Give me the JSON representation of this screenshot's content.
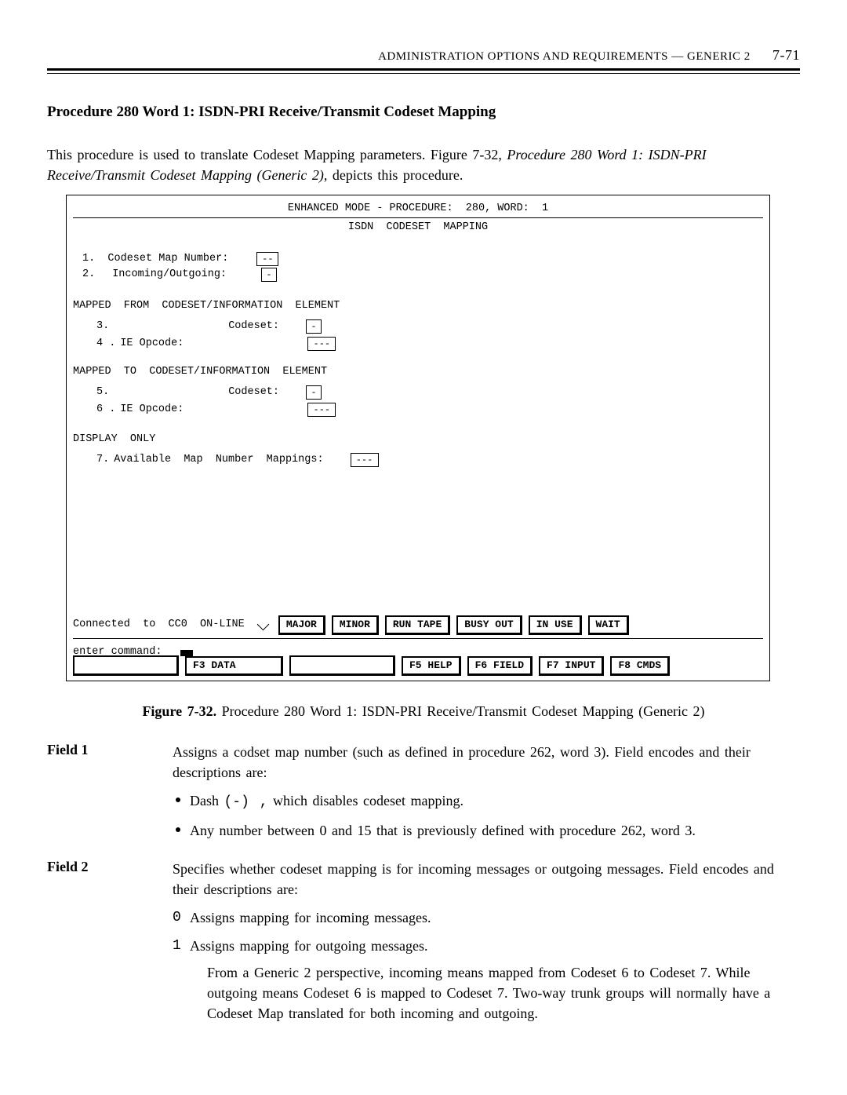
{
  "header": {
    "running": "ADMINISTRATION  OPTIONS  AND  REQUIREMENTS   —   GENERIC  2",
    "page_number": "7-71"
  },
  "section_title": "Procedure 280 Word 1: ISDN-PRI Receive/Transmit Codeset Mapping",
  "intro_prefix": "This  procedure  is  used  to  translate  Codeset  Mapping  parameters.  Figure  7-32, ",
  "intro_em": "Procedure  280 Word 1: ISDN-PRI Receive/Transmit Codeset Mapping (Generic 2),",
  "intro_suffix": " depicts this procedure.",
  "terminal": {
    "line1": "ENHANCED MODE - PROCEDURE:  280, WORD:  1",
    "line2": "ISDN  CODESET  MAPPING",
    "l_cmap_label": "1.  Codeset Map Number:",
    "l_cmap_val": "--",
    "l_inout_no": "2.",
    "l_inout_label": "Incoming/Outgoing:",
    "l_inout_val": "-",
    "grp1_title": "MAPPED  FROM  CODESET/INFORMATION  ELEMENT",
    "g1a_no": "3.",
    "g1a_label": "Codeset:",
    "g1a_val": "-",
    "g1b_no": "4 .",
    "g1b_label": "IE Opcode:",
    "g1b_val": "---",
    "grp2_title": "MAPPED  TO  CODESET/INFORMATION  ELEMENT",
    "g2a_no": "5.",
    "g2a_label": "Codeset:",
    "g2a_val": "-",
    "g2b_no": "6 .",
    "g2b_label": "IE Opcode:",
    "g2b_val": "---",
    "disp_title": "DISPLAY  ONLY",
    "disp_no": "7.",
    "disp_label": "Available  Map  Number  Mappings:",
    "disp_val": "---",
    "status_prefix": "Connected  to  CC0  ON-LINE ",
    "btn_major": "MAJOR",
    "btn_minor": "MINOR",
    "btn_run": "RUN TAPE",
    "btn_busy": "BUSY OUT",
    "btn_inuse": "IN USE",
    "btn_wait": "WAIT",
    "cmd_label": "enter  command:",
    "f3": "F3 DATA",
    "f5": "F5 HELP",
    "f6": "F6 FIELD",
    "f7": "F7 INPUT",
    "f8": "F8 CMDS"
  },
  "caption_bold": "Figure 7-32.",
  "caption_rest": " Procedure 280 Word 1: ISDN-PRI Receive/Transmit Codeset Mapping (Generic 2)",
  "fields": {
    "f1": {
      "label": "Field 1",
      "para": "Assigns a codset map number (such as defined in procedure 262, word 3). Field encodes and their descriptions are:",
      "b1_pre": "Dash  ",
      "b1_code": "(-) ,",
      "b1_post": "   which disables codeset mapping.",
      "b2": "Any number between 0 and 15 that is previously defined with procedure 262, word 3."
    },
    "f2": {
      "label": "Field 2",
      "para": "Specifies whether codeset mapping is for incoming messages or outgoing messages. Field encodes and their descriptions are:",
      "n0_code": "0",
      "n0": "Assigns mapping for incoming messages.",
      "n1_code": "1",
      "n1": "Assigns mapping for outgoing messages.",
      "note": "From a Generic 2 perspective, incoming means mapped from Codeset 6 to Codeset 7. While outgoing means Codeset 6 is mapped to Codeset 7. Two-way trunk groups will normally have a Codeset Map translated for both incoming and outgoing."
    }
  }
}
